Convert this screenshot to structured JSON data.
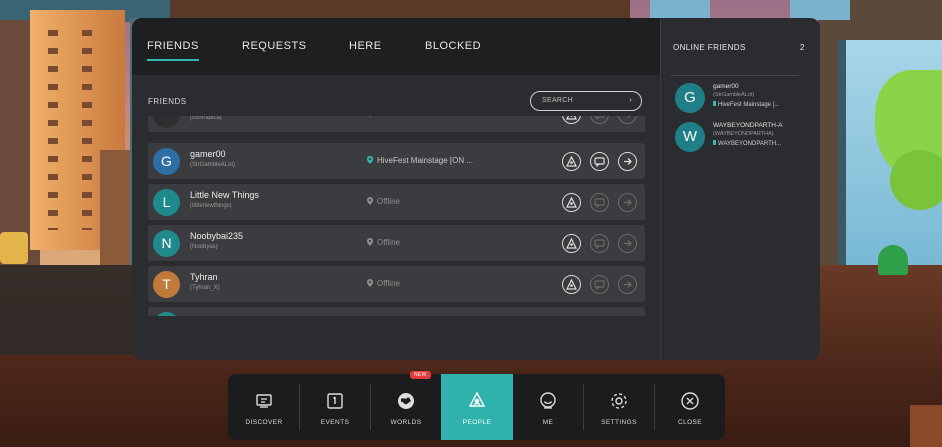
{
  "tabs": [
    {
      "label": "FRIENDS",
      "active": true
    },
    {
      "label": "REQUESTS",
      "active": false
    },
    {
      "label": "HERE",
      "active": false
    },
    {
      "label": "BLOCKED",
      "active": false
    }
  ],
  "section_label": "FRIENDS",
  "search": {
    "label": "SEARCH",
    "caret": "›"
  },
  "friends": [
    {
      "initial": "",
      "name": "comradica",
      "handle": "(comradica)",
      "location": "Offline",
      "online": false,
      "color": "#2e2e30"
    },
    {
      "initial": "G",
      "name": "gamer00",
      "handle": "(StrGambleALot)",
      "location": "HiveFest Mainstage [ON ...",
      "online": true,
      "color": "#2d6fa5"
    },
    {
      "initial": "L",
      "name": "Little New Things",
      "handle": "(littlenewthings)",
      "location": "Offline",
      "online": false,
      "color": "#1f8a8c"
    },
    {
      "initial": "N",
      "name": "Noobybai235",
      "handle": "(Noobyas)",
      "location": "Offline",
      "online": false,
      "color": "#1f8a8c"
    },
    {
      "initial": "T",
      "name": "Tyhran",
      "handle": "(Tyhran_X)",
      "location": "Offline",
      "online": false,
      "color": "#c07a3a"
    },
    {
      "initial": "",
      "name": "",
      "handle": "",
      "location": "",
      "online": false,
      "color": "#1f8a8c"
    }
  ],
  "online_panel": {
    "title": "ONLINE FRIENDS",
    "count": "2",
    "items": [
      {
        "initial": "G",
        "name": "gamer00",
        "handle": "(StrGambleALot)",
        "location": "HiveFest Mainstage [..."
      },
      {
        "initial": "W",
        "name": "WAYBEYONDPARTH-A",
        "handle": "(WAYBEYONDPARTHA)",
        "location": "WAYBEYONDPARTH..."
      }
    ]
  },
  "dock": [
    {
      "label": "DISCOVER",
      "icon": "discover-icon",
      "active": false
    },
    {
      "label": "EVENTS",
      "icon": "calendar-icon",
      "active": false
    },
    {
      "label": "WORLDS",
      "icon": "globe-icon",
      "active": false,
      "badge": "NEW"
    },
    {
      "label": "PEOPLE",
      "icon": "people-icon",
      "active": true
    },
    {
      "label": "ME",
      "icon": "avatar-icon",
      "active": false
    },
    {
      "label": "SETTINGS",
      "icon": "gear-icon",
      "active": false
    },
    {
      "label": "CLOSE",
      "icon": "close-icon",
      "active": false
    }
  ],
  "colors": {
    "accent": "#2fb2ac",
    "panel": "#2b2c2f",
    "row": "#3b3c3f",
    "badge": "#e23b3b"
  }
}
